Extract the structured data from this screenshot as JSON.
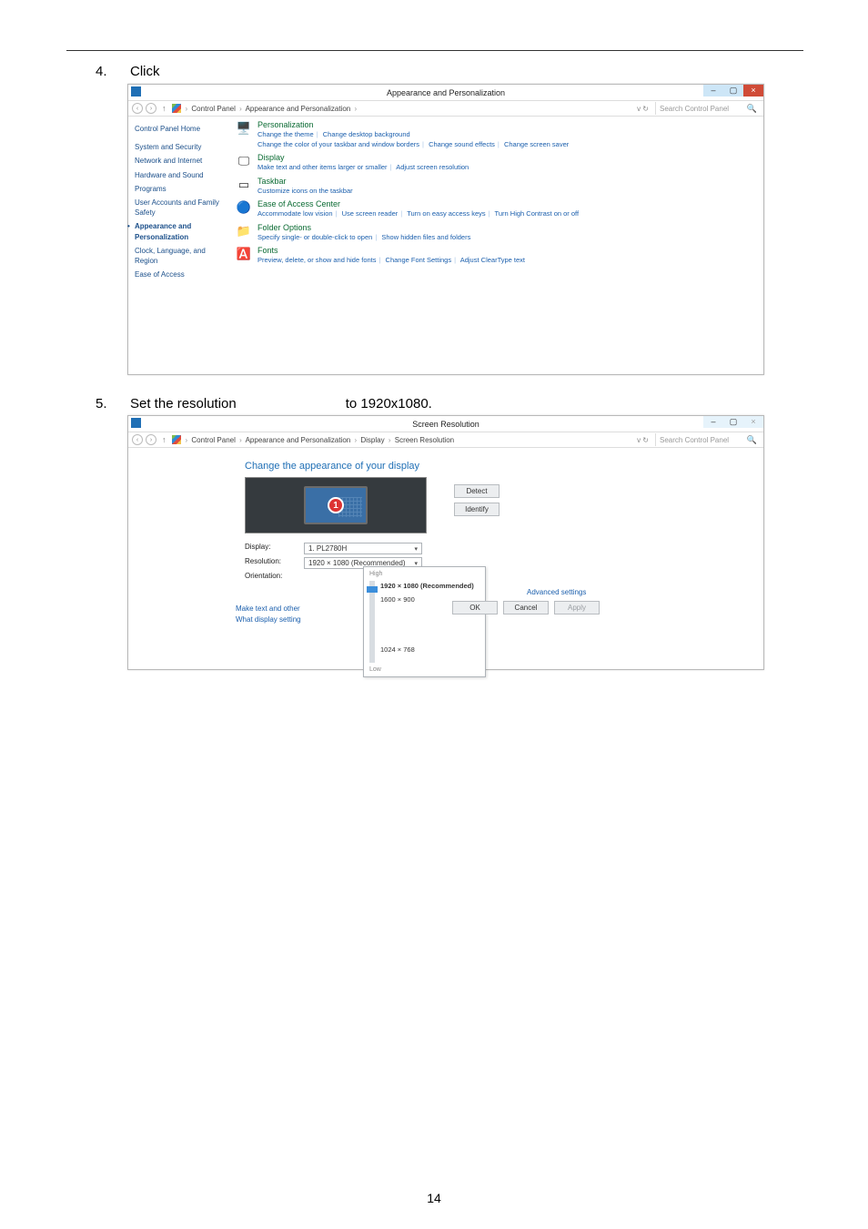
{
  "page_number": "14",
  "steps": {
    "s4": {
      "num": "4.",
      "text": "Click"
    },
    "s5": {
      "num": "5.",
      "text_a": "Set the resolution",
      "text_b": "to 1920x1080."
    }
  },
  "win1": {
    "title": "Appearance and Personalization",
    "breadcrumb": {
      "seg1": "Control Panel",
      "seg2": "Appearance and Personalization"
    },
    "search_placeholder": "Search Control Panel",
    "refresh_glyph": "v  ↻",
    "minus": "–",
    "square": "▢",
    "x": "×",
    "sidebar": {
      "i0": "Control Panel Home",
      "i1": "System and Security",
      "i2": "Network and Internet",
      "i3": "Hardware and Sound",
      "i4": "Programs",
      "i5": "User Accounts and Family Safety",
      "i6": "Appearance and Personalization",
      "i7": "Clock, Language, and Region",
      "i8": "Ease of Access"
    },
    "cats": {
      "c0": {
        "title": "Personalization",
        "l1": "Change the theme",
        "l2": "Change desktop background",
        "l3": "Change the color of your taskbar and window borders",
        "l4": "Change sound effects",
        "l5": "Change screen saver"
      },
      "c1": {
        "title": "Display",
        "l1": "Make text and other items larger or smaller",
        "l2": "Adjust screen resolution"
      },
      "c2": {
        "title": "Taskbar",
        "l1": "Customize icons on the taskbar"
      },
      "c3": {
        "title": "Ease of Access Center",
        "l1": "Accommodate low vision",
        "l2": "Use screen reader",
        "l3": "Turn on easy access keys",
        "l4": "Turn High Contrast on or off"
      },
      "c4": {
        "title": "Folder Options",
        "l1": "Specify single- or double-click to open",
        "l2": "Show hidden files and folders"
      },
      "c5": {
        "title": "Fonts",
        "l1": "Preview, delete, or show and hide fonts",
        "l2": "Change Font Settings",
        "l3": "Adjust ClearType text"
      }
    }
  },
  "win2": {
    "title": "Screen Resolution",
    "breadcrumb": {
      "seg1": "Control Panel",
      "seg2": "Appearance and Personalization",
      "seg3": "Display",
      "seg4": "Screen Resolution"
    },
    "search_placeholder": "Search Control Panel",
    "refresh_glyph": "v  ↻",
    "minus": "–",
    "square": "▢",
    "x": "×",
    "heading": "Change the appearance of your display",
    "monitor_number": "1",
    "btn_detect": "Detect",
    "btn_identify": "Identify",
    "rows": {
      "display_lbl": "Display:",
      "display_val": "1. PL2780H",
      "resolution_lbl": "Resolution:",
      "resolution_val": "1920 × 1080 (Recommended)",
      "orientation_lbl": "Orientation:"
    },
    "popup": {
      "top_lbl": "High",
      "opt1": "1920 × 1080 (Recommended)",
      "opt2": "1600 × 900",
      "opt3": "1024 × 768",
      "bottom_lbl": "Low"
    },
    "links": {
      "l1": "Advanced settings",
      "l2": "Make text and other",
      "l3": "What display setting"
    },
    "buttons": {
      "ok": "OK",
      "cancel": "Cancel",
      "apply": "Apply"
    }
  }
}
